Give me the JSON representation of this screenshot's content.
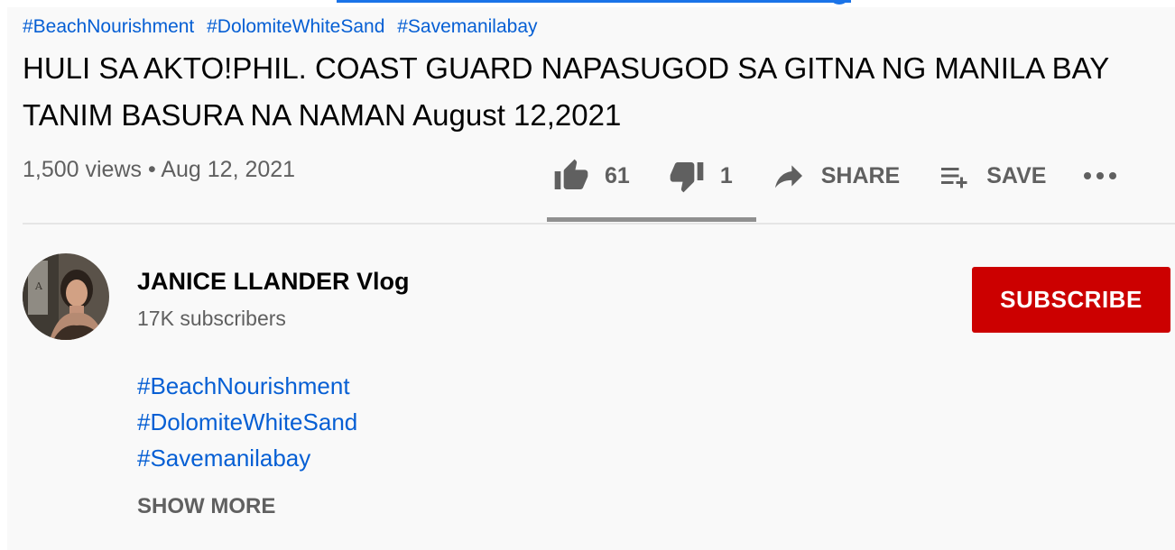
{
  "player": {
    "progress_fraction": 0.99
  },
  "video": {
    "hashtags_top": [
      "#BeachNourishment",
      "#DolomiteWhiteSand",
      "#Savemanilabay"
    ],
    "title_line1": "HULI SA AKTO!PHIL. COAST GUARD NAPASUGOD SA GITNA NG MANILA BAY",
    "title_line2": "TANIM BASURA NA NAMAN August 12,2021",
    "views": "1,500 views",
    "separator": "•",
    "date": "Aug 12, 2021"
  },
  "actions": {
    "likes": "61",
    "dislikes": "1",
    "share_label": "SHARE",
    "save_label": "SAVE",
    "like_ratio": 0.98
  },
  "channel": {
    "name": "JANICE LLANDER Vlog",
    "subscribers": "17K subscribers",
    "subscribe_label": "SUBSCRIBE"
  },
  "description": {
    "hashtags": [
      "#BeachNourishment",
      "#DolomiteWhiteSand",
      "#Savemanilabay"
    ],
    "show_more_label": "SHOW MORE"
  },
  "colors": {
    "link": "#065fd4",
    "subscribe_bg": "#cc0000",
    "text_primary": "#030303",
    "text_secondary": "#606060",
    "progress": "#1a73e8"
  },
  "icons": [
    "thumb-up-icon",
    "thumb-down-icon",
    "share-arrow-icon",
    "playlist-add-icon",
    "more-horizontal-icon"
  ]
}
